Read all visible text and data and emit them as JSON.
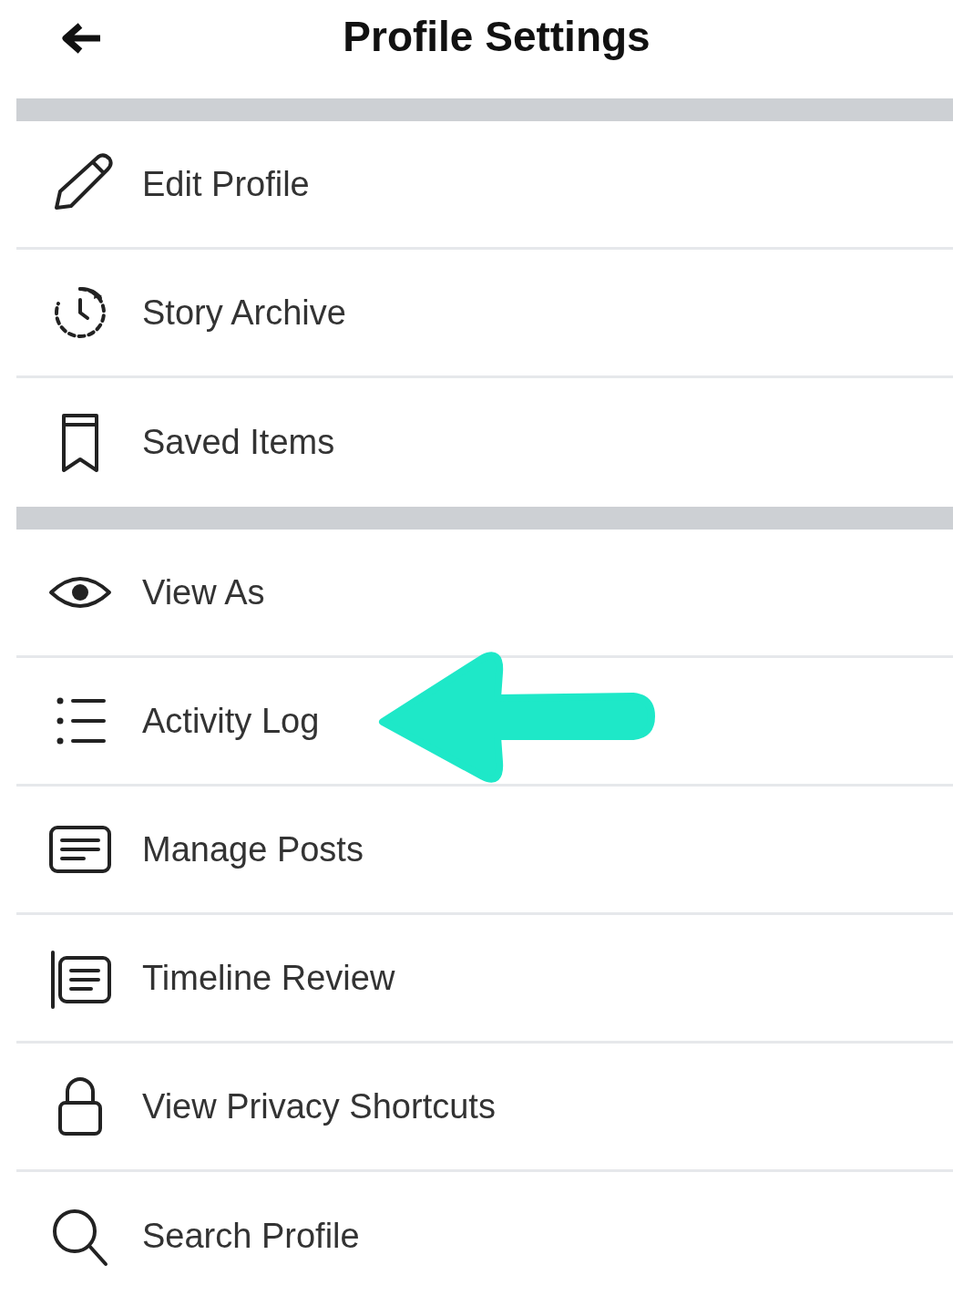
{
  "header": {
    "title": "Profile Settings"
  },
  "sections": [
    {
      "items": [
        {
          "label": "Edit Profile"
        },
        {
          "label": "Story Archive"
        },
        {
          "label": "Saved Items"
        }
      ]
    },
    {
      "items": [
        {
          "label": "View As"
        },
        {
          "label": "Activity Log"
        },
        {
          "label": "Manage Posts"
        },
        {
          "label": "Timeline Review"
        },
        {
          "label": "View Privacy Shortcuts"
        },
        {
          "label": "Search Profile"
        }
      ]
    }
  ]
}
